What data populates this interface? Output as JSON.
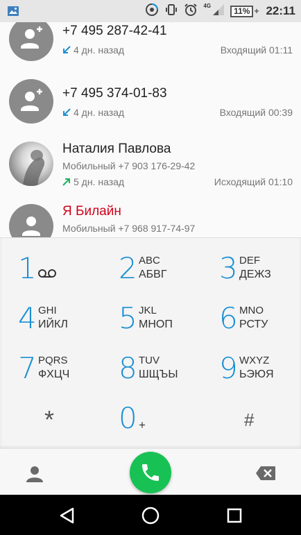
{
  "status_bar": {
    "network": "4G",
    "battery": "11%",
    "battery_plus": "+",
    "time": "22:11",
    "icons": [
      "image-notification-icon",
      "data-saver-icon",
      "vibrate-icon",
      "alarm-icon",
      "signal-icon",
      "battery-icon"
    ]
  },
  "call_log": [
    {
      "name": "+7 495 287-42-41",
      "name_color": "#222222",
      "subtitle": "",
      "when": "4 дн. назад",
      "direction": "incoming",
      "call_type": "Входящий 01:11",
      "avatar": "add-contact-icon"
    },
    {
      "name": "+7 495 374-01-83",
      "name_color": "#222222",
      "subtitle": "",
      "when": "4 дн. назад",
      "direction": "incoming",
      "call_type": "Входящий 00:39",
      "avatar": "add-contact-icon"
    },
    {
      "name": "Наталия Павлова",
      "name_color": "#222222",
      "subtitle": "Мобильный +7 903 176-29-42",
      "when": "5 дн. назад",
      "direction": "outgoing",
      "call_type": "Исходящий 01:10",
      "avatar": "contact-photo"
    },
    {
      "name": "Я Билайн",
      "name_color": "#d0021b",
      "subtitle": "Мобильный +7 968 917-74-97",
      "when": "",
      "direction": "",
      "call_type": "",
      "avatar": "person-icon"
    }
  ],
  "keypad": {
    "keys": [
      {
        "digit": "1",
        "lat": "",
        "cyr": "",
        "icon": "voicemail-icon"
      },
      {
        "digit": "2",
        "lat": "ABC",
        "cyr": "АБВГ"
      },
      {
        "digit": "3",
        "lat": "DEF",
        "cyr": "ДЕЖЗ"
      },
      {
        "digit": "4",
        "lat": "GHI",
        "cyr": "ИЙКЛ"
      },
      {
        "digit": "5",
        "lat": "JKL",
        "cyr": "МНОП"
      },
      {
        "digit": "6",
        "lat": "MNO",
        "cyr": "РСТУ"
      },
      {
        "digit": "7",
        "lat": "PQRS",
        "cyr": "ФХЦЧ"
      },
      {
        "digit": "8",
        "lat": "TUV",
        "cyr": "ШЩЪЫ"
      },
      {
        "digit": "9",
        "lat": "WXYZ",
        "cyr": "ЬЭЮЯ"
      }
    ],
    "star": "*",
    "zero": "0",
    "zero_plus": "+",
    "hash": "#"
  },
  "action_bar": {
    "contacts_icon": "contacts-icon",
    "call_icon": "phone-icon",
    "call_color": "#18c153",
    "backspace_icon": "backspace-icon"
  },
  "nav_bar": {
    "icons": [
      "back-icon",
      "home-icon",
      "recents-icon"
    ]
  },
  "colors": {
    "accent": "#1a8fd3",
    "incoming_arrow": "#1a8fd3",
    "outgoing_arrow": "#19b35a"
  }
}
